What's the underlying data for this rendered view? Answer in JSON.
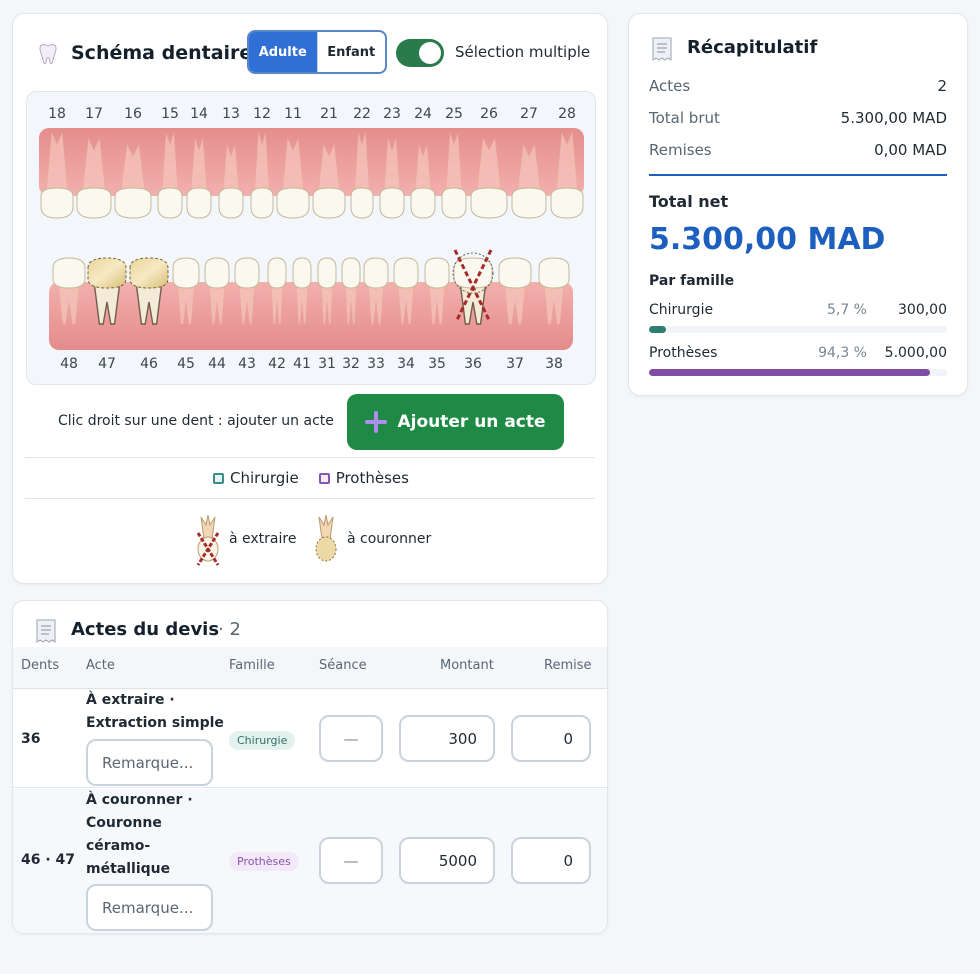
{
  "schema": {
    "title": "Schéma dentaire",
    "seg_adulte": "Adulte",
    "seg_enfant": "Enfant",
    "toggle_label": "Sélection multiple",
    "upper_teeth": [
      "18",
      "17",
      "16",
      "15",
      "14",
      "13",
      "12",
      "11",
      "21",
      "22",
      "23",
      "24",
      "25",
      "26",
      "27",
      "28"
    ],
    "lower_teeth": [
      "48",
      "47",
      "46",
      "45",
      "44",
      "43",
      "42",
      "41",
      "31",
      "32",
      "33",
      "34",
      "35",
      "36",
      "37",
      "38"
    ],
    "hint": "Clic droit sur une dent : ajouter un acte",
    "add_button": "Ajouter un acte",
    "legend": [
      {
        "label": "Chirurgie",
        "color": "#3a8c86"
      },
      {
        "label": "Prothèses",
        "color": "#8a55b0"
      }
    ],
    "legend_marks": [
      {
        "label": "à extraire"
      },
      {
        "label": "à couronner"
      }
    ]
  },
  "recap": {
    "title": "Récapitulatif",
    "rows": [
      {
        "label": "Actes",
        "value": "2"
      },
      {
        "label": "Total brut",
        "value": "5.300,00 MAD"
      },
      {
        "label": "Remises",
        "value": "0,00 MAD"
      }
    ],
    "total_label": "Total net",
    "total_value": "5.300,00 MAD",
    "par_famille": "Par famille",
    "familles": [
      {
        "name": "Chirurgie",
        "pct": "5,7 %",
        "value": "300,00",
        "fraction": 0.057,
        "color": "#2f7e72"
      },
      {
        "name": "Prothèses",
        "pct": "94,3 %",
        "value": "5.000,00",
        "fraction": 0.943,
        "color": "#7e4ea6"
      }
    ]
  },
  "actes": {
    "title": "Actes du devis",
    "count": "· 2",
    "headers": [
      "Dents",
      "Acte",
      "Famille",
      "Séance",
      "Montant",
      "Remise"
    ],
    "rows": [
      {
        "dents": "36",
        "acte_line1": "À extraire ·",
        "acte_line2": "Extraction simple",
        "remarque_placeholder": "Remarque...",
        "famille": "Chirurgie",
        "seance": "—",
        "montant": "300",
        "remise": "0"
      },
      {
        "dents": "46 · 47",
        "acte_line1": "À couronner ·",
        "acte_line2": "Couronne",
        "acte_line3": "céramo-",
        "acte_line4": "métallique",
        "remarque_placeholder": "Remarque...",
        "famille": "Prothèses",
        "seance": "—",
        "montant": "5000",
        "remise": "0"
      }
    ]
  },
  "colors": {
    "primary_blue": "#2f6fd6",
    "green": "#1f8a45",
    "total_blue": "#1d5fbf"
  }
}
